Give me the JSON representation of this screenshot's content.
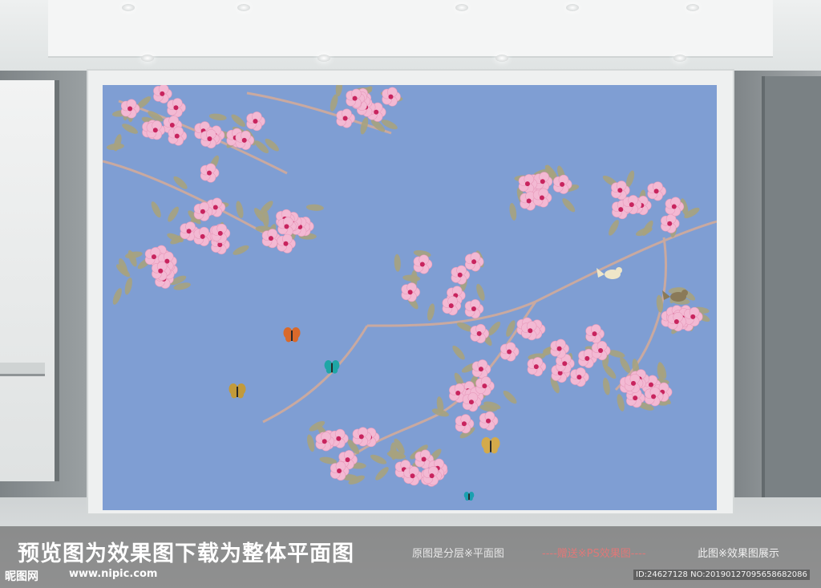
{
  "caption": {
    "main": "预览图为效果图下载为整体平面图",
    "note_original": "原图是分层※平面图",
    "note_gift": "----赠送※PS效果图----",
    "note_preview": "此图※效果图展示"
  },
  "watermark": {
    "logo": "昵图网",
    "site": "www.nipic.com",
    "id_line": "ID:24627128 NO:20190127095658682086"
  },
  "colors": {
    "mural_background": "#7f9ed3",
    "blossom": "#f3b9d3",
    "blossom_center": "#c8245e",
    "leaf": "#a7a27e",
    "branch": "#c9a9a0"
  },
  "icons": [
    "peach-blossom-icon",
    "butterfly-icon",
    "bird-icon",
    "spotlight-icon"
  ]
}
